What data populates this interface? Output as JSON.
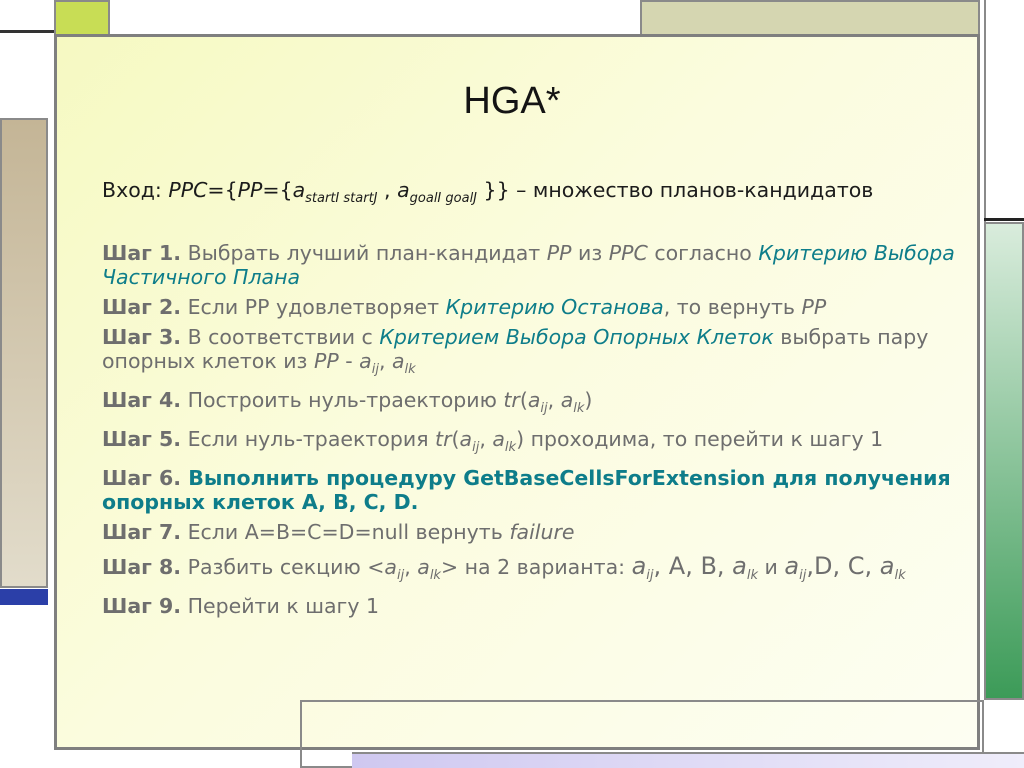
{
  "title": "HGA*",
  "input": {
    "label": "Вход: ",
    "ppc": "PPC",
    "eq1": "={",
    "pp": "PP",
    "eq2": "={",
    "a1": "a",
    "a1_sub": "startI startJ",
    "comma": " , ",
    "a2": "a",
    "a2_sub": "goalI goalJ",
    "close": " }}",
    "rest": " – множество планов-кандидатов"
  },
  "steps": {
    "s1": {
      "label": "Шаг 1.",
      "t1": " Выбрать лучший план-кандидат ",
      "pp": "PP",
      "t2": " из ",
      "ppc": "PPC",
      "t3": " согласно ",
      "crit": "Критерию Выбора Частичного Плана"
    },
    "s2": {
      "label": "Шаг 2.",
      "t1": " Если PP удовлетворяет ",
      "crit": "Критерию Останова",
      "t2": ", то вернуть ",
      "pp": "PP"
    },
    "s3": {
      "label": "Шаг 3.",
      "t1": " В соответствии с ",
      "crit": "Критерием Выбора Опорных Клеток",
      "t2": " выбрать пару опорных клеток из ",
      "pp": "PP",
      "t3": " - ",
      "a": "a",
      "ij": "ij",
      "sep": ", ",
      "lk": "lk"
    },
    "s4": {
      "label": "Шаг 4.",
      "t1": " Построить нуль-траекторию ",
      "tr": "tr",
      "open": "(",
      "a": "a",
      "ij": "ij",
      "sep": ", ",
      "lk": "lk",
      "close": ")"
    },
    "s5": {
      "label": "Шаг 5.",
      "t1": " Если нуль-траектория ",
      "tr": "tr",
      "open": "(",
      "a": "a",
      "ij": "ij",
      "sep": ", ",
      "lk": "lk",
      "t2": ") проходима, то перейти к шагу 1"
    },
    "s6": {
      "label": "Шаг 6.",
      "t1": " Выполнить процедуру GetBaseCellsForExtension для получения опорных клеток A, B, C, D."
    },
    "s7": {
      "label": "Шаг 7.",
      "t1": " Если A=B=C=D=null вернуть ",
      "failure": "failure"
    },
    "s8": {
      "label": "Шаг 8.",
      "t1": " Разбить секцию <",
      "a": "a",
      "ij": "ij",
      "sep": ", ",
      "lk": "lk",
      "t2": "> на 2 варианта: ",
      "t3": ", A, B, ",
      "t4": " и ",
      "t5": ",D, C, "
    },
    "s9": {
      "label": "Шаг 9.",
      "t1": " Перейти к шагу 1"
    }
  },
  "colors": {
    "slide_bg": "#f8fad0",
    "accent_green": "#c8dd55",
    "accent_tan": "#c8b99a",
    "accent_olive": "#d5d6b1",
    "accent_darkgreen": "#3c9b58",
    "accent_blue": "#2b3fa8",
    "highlight_teal": "#0e7d8a"
  }
}
